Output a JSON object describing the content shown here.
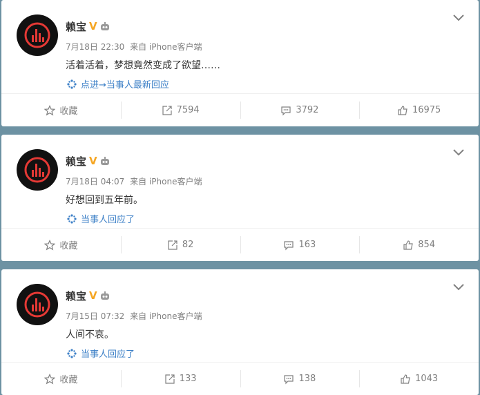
{
  "posts": [
    {
      "author": "赖宝",
      "badge": "V",
      "date": "7月18日 22:30",
      "source": "来自 iPhone客户端",
      "text": "活着活着，梦想竟然变成了欲望……",
      "reply_link": "点进→当事人最新回应",
      "actions": {
        "favorite": "收藏",
        "repost": "7594",
        "comment": "3792",
        "like": "16975"
      }
    },
    {
      "author": "赖宝",
      "badge": "V",
      "date": "7月18日 04:07",
      "source": "来自 iPhone客户端",
      "text": "好想回到五年前。",
      "reply_link": "当事人回应了",
      "actions": {
        "favorite": "收藏",
        "repost": "82",
        "comment": "163",
        "like": "854"
      }
    },
    {
      "author": "赖宝",
      "badge": "V",
      "date": "7月15日 07:32",
      "source": "来自 iPhone客户端",
      "text": "人间不哀。",
      "reply_link": "当事人回应了",
      "actions": {
        "favorite": "收藏",
        "repost": "133",
        "comment": "138",
        "like": "1043"
      }
    }
  ],
  "colors": {
    "background": "#6d92a3",
    "link": "#3d80c7",
    "verified": "#f5a623",
    "avatar_accent": "#e53935"
  },
  "icons": [
    "avatar-power-icon",
    "verified-v-icon",
    "robot-icon",
    "chevron-down-icon",
    "sparkle-icon",
    "star-icon",
    "repost-icon",
    "comment-icon",
    "thumb-up-icon"
  ]
}
